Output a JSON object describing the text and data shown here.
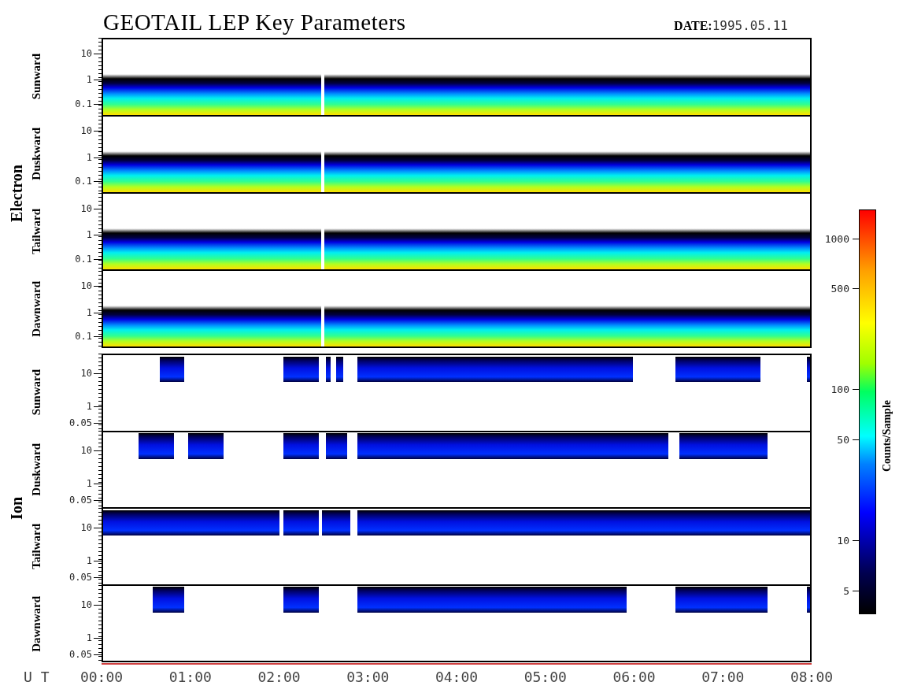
{
  "title": "GEOTAIL LEP Key Parameters",
  "date": {
    "label": "DATE:",
    "value": "1995.05.11"
  },
  "groups": [
    {
      "name": "Electron",
      "kind": "electron",
      "panels": [
        {
          "label": "Sunward",
          "ticks": [
            "10",
            "1",
            "0.1"
          ]
        },
        {
          "label": "Duskward",
          "ticks": [
            "10",
            "1",
            "0.1"
          ]
        },
        {
          "label": "Tailward",
          "ticks": [
            "10",
            "1",
            "0.1"
          ]
        },
        {
          "label": "Dawnward",
          "ticks": [
            "10",
            "1",
            "0.1"
          ]
        }
      ]
    },
    {
      "name": "Ion",
      "kind": "ion",
      "panels": [
        {
          "label": "Sunward",
          "ticks": [
            "10",
            "1",
            "0.05"
          ]
        },
        {
          "label": "Duskward",
          "ticks": [
            "10",
            "1",
            "0.05"
          ]
        },
        {
          "label": "Tailward",
          "ticks": [
            "10",
            "1",
            "0.05"
          ]
        },
        {
          "label": "Dawnward",
          "ticks": [
            "10",
            "1",
            "0.05"
          ]
        }
      ]
    }
  ],
  "time_axis": {
    "label": "U T",
    "ticks": [
      "00:00",
      "01:00",
      "02:00",
      "03:00",
      "04:00",
      "05:00",
      "06:00",
      "07:00",
      "08:00"
    ]
  },
  "colorbar": {
    "label": "Counts/Sample",
    "ticks": [
      "1000",
      "500",
      "100",
      "50",
      "10",
      "5"
    ]
  }
}
